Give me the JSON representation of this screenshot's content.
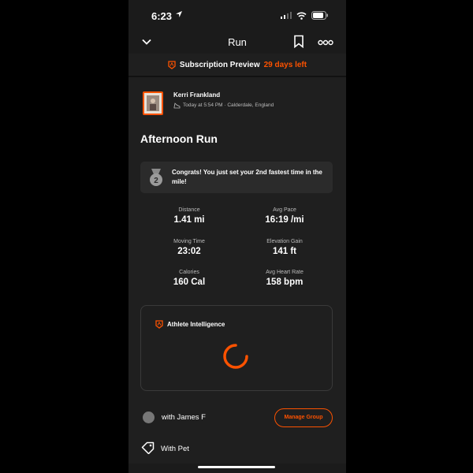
{
  "status_bar": {
    "time": "6:23"
  },
  "nav": {
    "title": "Run"
  },
  "subscription": {
    "label": "Subscription Preview",
    "days_left": "29 days left"
  },
  "athlete": {
    "name": "Kerri Frankland",
    "meta": "Today at 5:54 PM · Calderdale, England"
  },
  "activity": {
    "title": "Afternoon Run"
  },
  "achievement": {
    "text": "Congrats! You just set your 2nd fastest time in the mile!",
    "badge_number": "2"
  },
  "stats": [
    {
      "label": "Distance",
      "value": "1.41 mi"
    },
    {
      "label": "Avg Pace",
      "value": "16:19 /mi"
    },
    {
      "label": "Moving Time",
      "value": "23:02"
    },
    {
      "label": "Elevation Gain",
      "value": "141 ft"
    },
    {
      "label": "Calories",
      "value": "160 Cal"
    },
    {
      "label": "Avg Heart Rate",
      "value": "158 bpm"
    }
  ],
  "athlete_intelligence": {
    "title": "Athlete Intelligence"
  },
  "group": {
    "text": "with James F",
    "button": "Manage Group"
  },
  "pet": {
    "text": "With Pet"
  },
  "colors": {
    "accent": "#fc5200",
    "background": "#1f1f1f",
    "card": "#2b2b2b"
  }
}
